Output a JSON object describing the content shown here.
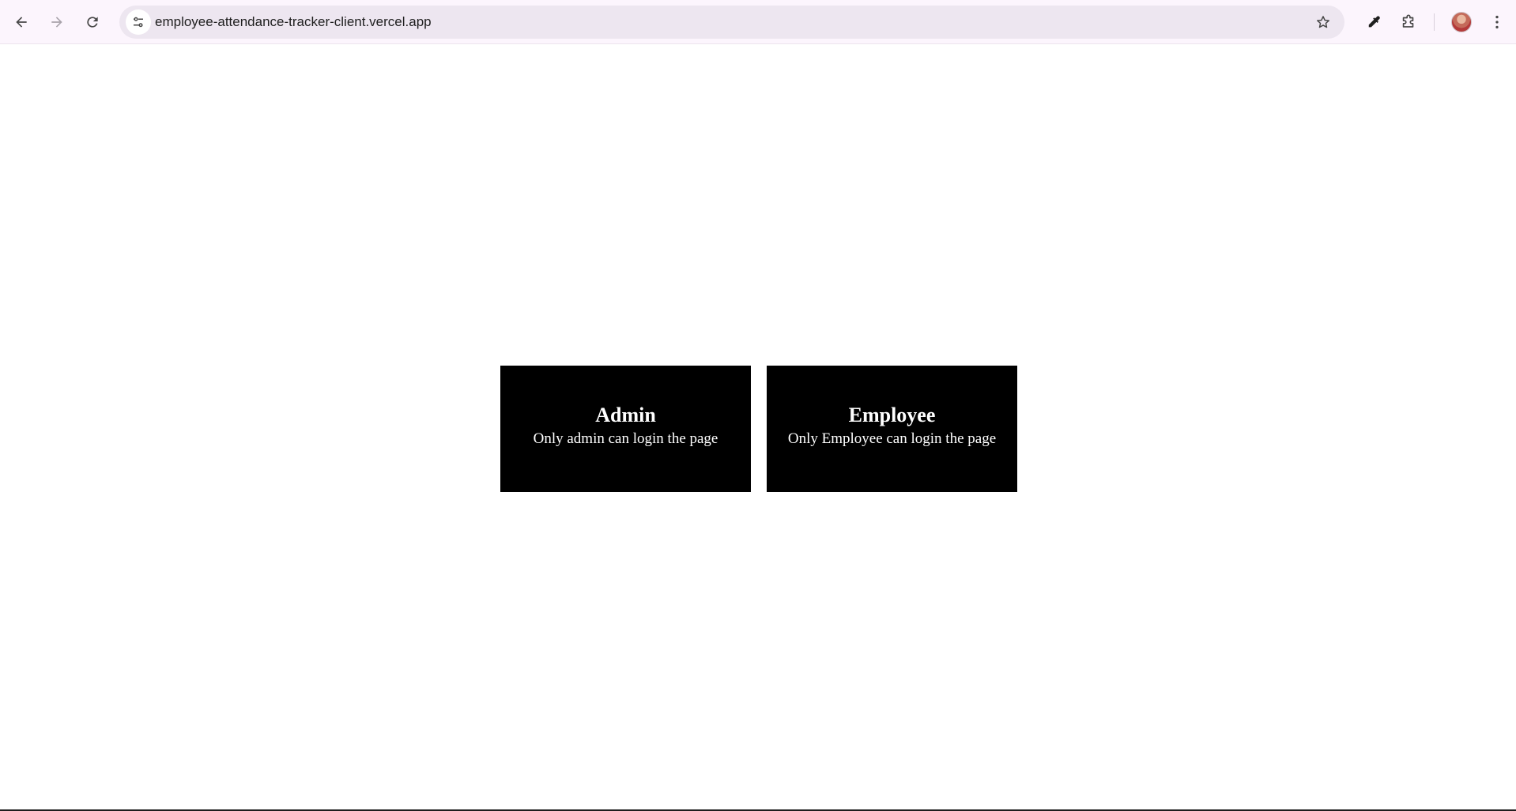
{
  "browser": {
    "url": "employee-attendance-tracker-client.vercel.app",
    "icons": {
      "back": "arrow-left-icon",
      "forward": "arrow-right-icon",
      "reload": "reload-icon",
      "site_info": "tune-icon",
      "bookmark": "star-icon",
      "eyedropper": "eyedropper-icon",
      "extensions": "puzzle-icon",
      "menu": "kebab-menu-icon"
    }
  },
  "cards": {
    "admin": {
      "title": "Admin",
      "description": "Only admin can login the page"
    },
    "employee": {
      "title": "Employee",
      "description": "Only Employee can login the page"
    }
  },
  "colors": {
    "card_background": "#000000",
    "card_text": "#ffffff",
    "toolbar_background": "#fcf5fd",
    "omnibox_background": "#ede6f0"
  }
}
